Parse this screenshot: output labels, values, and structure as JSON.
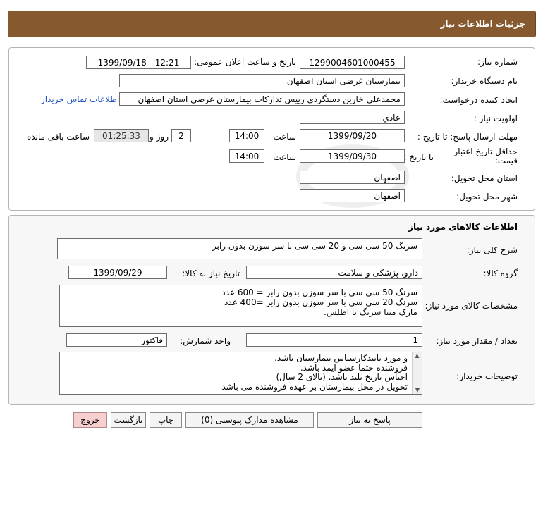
{
  "header": {
    "title": "جزئیات اطلاعات نیاز"
  },
  "info": {
    "need_number_label": "شماره نیاز:",
    "need_number": "1299004601000455",
    "announce_label": "تاریخ و ساعت اعلان عمومی:",
    "announce_value": "1399/09/18 - 12:21",
    "buyer_org_label": "نام دستگاه خریدار:",
    "buyer_org": "بیمارستان غرضی استان اصفهان",
    "requester_label": "ایجاد کننده درخواست:",
    "requester": "محمدعلی خارین دستگردی رییس تدارکات بیمارستان غرضی استان اصفهان",
    "contact_link": "اطلاعات تماس خریدار",
    "priority_label": "اولویت نیاز :",
    "priority": "عادي",
    "deadline_label": "مهلت ارسال پاسخ: تا تاریخ :",
    "deadline_date": "1399/09/20",
    "time_label": "ساعت",
    "deadline_time": "14:00",
    "days_value": "2",
    "days_label": "روز و",
    "remaining_value": "01:25:33",
    "remaining_label": "ساعت باقی مانده",
    "validity_label": "حداقل تاریخ اعتبار قیمت:",
    "validity_to_label": "تا تاریخ :",
    "validity_date": "1399/09/30",
    "validity_time": "14:00",
    "province_label": "استان محل تحویل:",
    "province": "اصفهان",
    "city_label": "شهر محل تحویل:",
    "city": "اصفهان"
  },
  "goods": {
    "title": "اطلاعات کالاهای مورد نیاز",
    "general_desc_label": "شرح کلی نیاز:",
    "general_desc": "سرنگ 50 سی سی و 20 سی سی با سر سوزن بدون رابر",
    "group_label": "گروه کالا:",
    "group": "دارو، پزشکی و سلامت",
    "need_date_label": "تاریخ نیاز به کالا:",
    "need_date": "1399/09/29",
    "specs_label": "مشخصات کالای مورد نیاز:",
    "specs_lines": [
      "سرنگ 50 سی سی با سر سوزن بدون رابر = 600 عدد",
      "سرنگ 20 سی سی با سر سوزن بدون رابر =400 عدد",
      "مارک مینا سرنگ یا اطلس."
    ],
    "qty_label": "تعداد / مقدار مورد نیاز:",
    "qty": "1",
    "unit_label": "واحد شمارش:",
    "unit": "فاکتور",
    "buyer_notes_label": "توضیحات خریدار:",
    "buyer_notes_lines": [
      "و مورد تاییدکارشناس بیمارستان باشد.",
      "فروشنده حتما عضو ایمد باشد.",
      "اجناس تاریخ بلند باشد. (بالای 2 سال)",
      "تحویل در محل بیمارستان بر عهده فروشنده می باشد"
    ]
  },
  "buttons": {
    "reply": "پاسخ به نیاز",
    "attachments": "مشاهده مدارک پیوستی (0)",
    "print": "چاپ",
    "back": "بازگشت",
    "exit": "خروج"
  },
  "colors": {
    "header_bg": "#86592f",
    "link": "#1a4fc4",
    "exit_btn": "#f8cfcf"
  }
}
